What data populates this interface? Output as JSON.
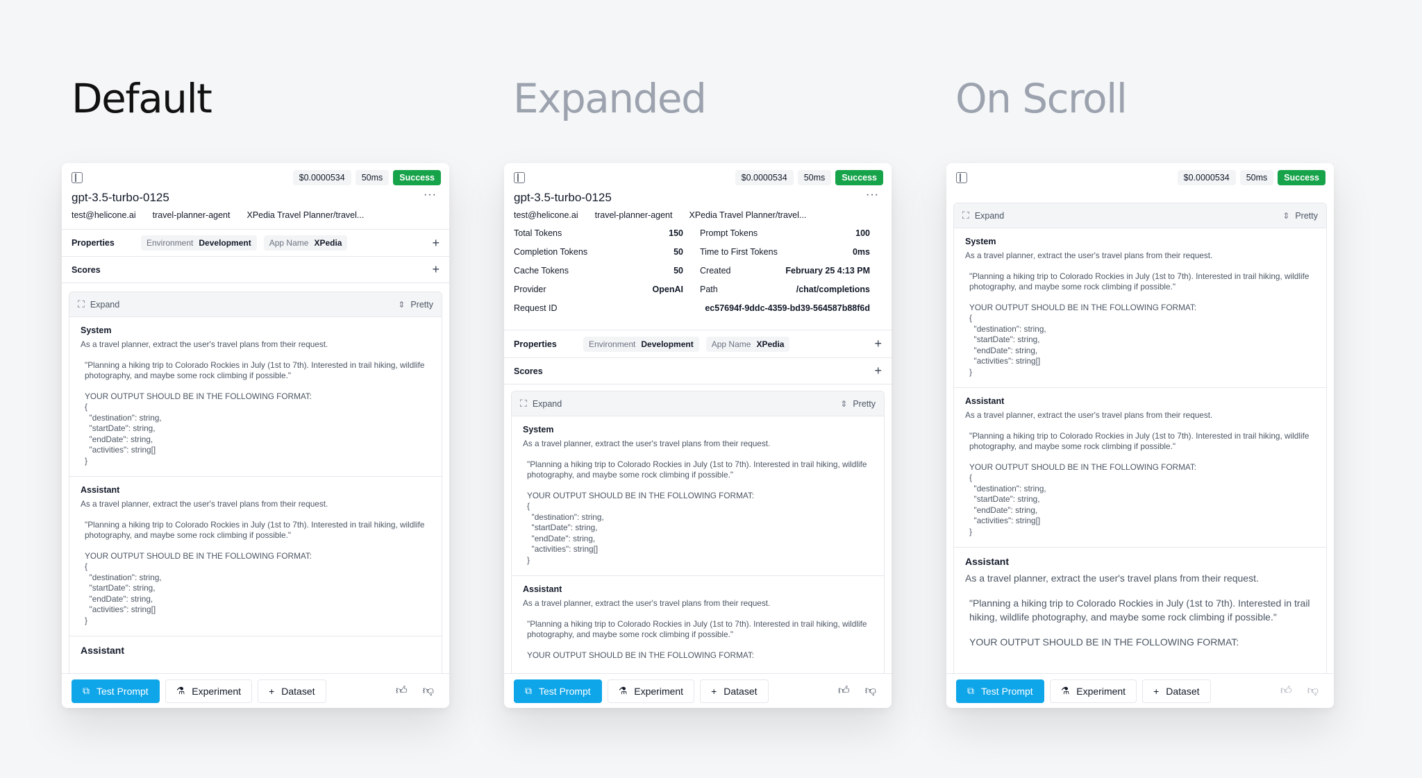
{
  "titles": {
    "default": "Default",
    "expanded": "Expanded",
    "scroll": "On Scroll"
  },
  "header": {
    "cost": "$0.0000534",
    "latency": "50ms",
    "status": "Success",
    "model": "gpt-3.5-turbo-0125",
    "more": "···",
    "user": "test@helicone.ai",
    "agent": "travel-planner-agent",
    "path_name": "XPedia Travel Planner/travel...",
    "path_name_short": "XPedia Travel Planner/travel..."
  },
  "metrics": {
    "total_tokens_label": "Total Tokens",
    "total_tokens": "150",
    "prompt_tokens_label": "Prompt Tokens",
    "prompt_tokens": "100",
    "completion_tokens_label": "Completion Tokens",
    "completion_tokens": "50",
    "ttft_label": "Time to First Tokens",
    "ttft": "0ms",
    "cache_tokens_label": "Cache Tokens",
    "cache_tokens": "50",
    "created_label": "Created",
    "created": "February 25 4:13 PM",
    "provider_label": "Provider",
    "provider": "OpenAI",
    "path_label": "Path",
    "path": "/chat/completions",
    "request_id_label": "Request ID",
    "request_id": "ec57694f-9ddc-4359-bd39-564587b88f6d"
  },
  "properties": {
    "label": "Properties",
    "env_key": "Environment",
    "env_value": "Development",
    "app_key": "App Name",
    "app_value": "XPedia"
  },
  "scores": {
    "label": "Scores"
  },
  "toolbar": {
    "expand": "Expand",
    "pretty": "Pretty"
  },
  "messages": {
    "system_role": "System",
    "assistant_role": "Assistant",
    "intro": "As a travel planner, extract the user's travel plans from their request.",
    "quote": "\"Planning a hiking trip to Colorado Rockies in July (1st to 7th). Interested in trail hiking, wildlife photography, and maybe some rock climbing if possible.\"",
    "format": "YOUR OUTPUT SHOULD BE IN THE FOLLOWING FORMAT:\n{\n  \"destination\": string,\n  \"startDate\": string,\n  \"endDate\": string,\n  \"activities\": string[]\n}",
    "format_head": "YOUR OUTPUT SHOULD BE IN THE FOLLOWING FORMAT:"
  },
  "footer": {
    "test_prompt": "Test Prompt",
    "experiment": "Experiment",
    "dataset": "Dataset"
  },
  "colors": {
    "success": "#16a34a",
    "primary": "#0ea5e9"
  }
}
